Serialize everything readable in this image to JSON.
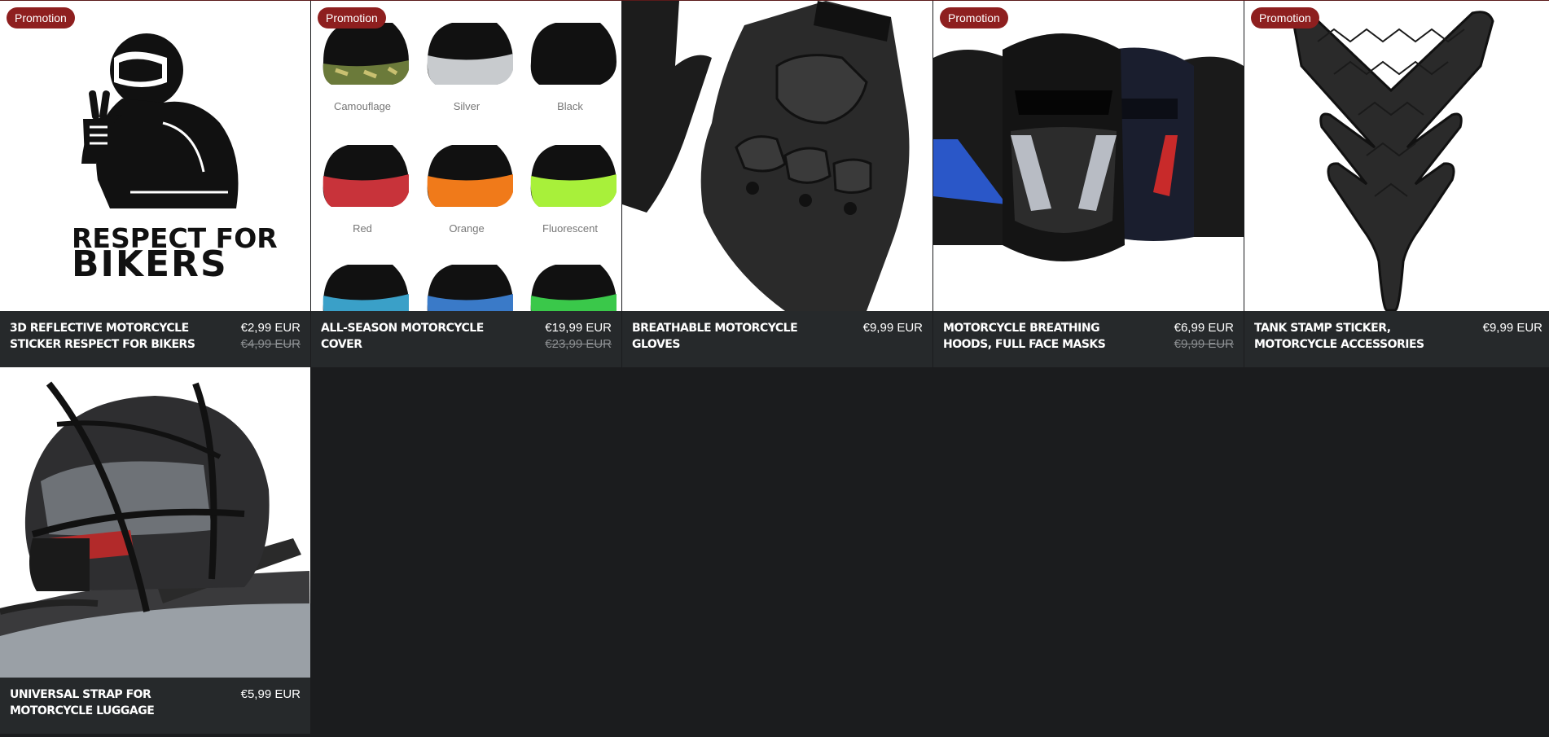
{
  "colors": {
    "badge": "#8e1f1f",
    "info_bar": "#26292b",
    "page_bg": "#1b1c1e"
  },
  "products": [
    {
      "badge": "Promotion",
      "title": "3D reflective motorcycle sticker respect for bikers",
      "price": "€2,99 EUR",
      "old_price": "€4,99 EUR",
      "image_text": [
        "RESPECT FOR",
        "BIKERS"
      ]
    },
    {
      "badge": "Promotion",
      "title": "All-season motorcycle cover",
      "price": "€19,99 EUR",
      "old_price": "€23,99 EUR",
      "variants": [
        "Camouflage",
        "Silver",
        "Black",
        "Red",
        "Orange",
        "Fluorescent"
      ]
    },
    {
      "title": "Breathable motorcycle gloves",
      "price": "€9,99 EUR"
    },
    {
      "badge": "Promotion",
      "title": "Motorcycle breathing hoods, full face masks",
      "price": "€6,99 EUR",
      "old_price": "€9,99 EUR"
    },
    {
      "badge": "Promotion",
      "title": "Tank stamp sticker, motorcycle accessories",
      "price": "€9,99 EUR"
    },
    {
      "title": "Universal strap for motorcycle luggage",
      "price": "€5,99 EUR"
    }
  ]
}
